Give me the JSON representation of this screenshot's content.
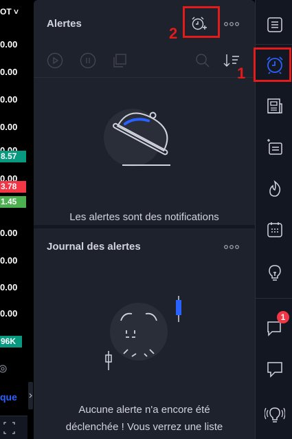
{
  "left_strip": {
    "header": "OT ˅",
    "prices": [
      "0.00",
      "0.00",
      "0.00",
      "0.00",
      "0.00",
      "0.00",
      "0.00",
      "0.00",
      "0.00",
      "0.00"
    ],
    "tags": [
      {
        "text": "8.57",
        "color": "#089981"
      },
      {
        "text": "3.78",
        "color": "#f23645"
      },
      {
        "text": "1.45",
        "color": "#4caf50"
      },
      {
        "text": "96K",
        "color": "#089981"
      }
    ],
    "more_label": "que"
  },
  "alerts_panel": {
    "title": "Alertes",
    "toolbar_icons": [
      "play-circle-icon",
      "pause-circle-icon",
      "copy-icon",
      "search-icon",
      "sort-icon"
    ],
    "empty_message": "Les alertes sont des notifications"
  },
  "log_panel": {
    "title": "Journal des alertes",
    "empty_message_line1": "Aucune alerte n'a encore été",
    "empty_message_line2": "déclenchée ! Vous verrez une liste"
  },
  "right_toolbar": {
    "items": [
      "watchlist-icon",
      "alarm-clock-icon",
      "news-icon",
      "screener-icon",
      "hotlist-icon",
      "calendar-icon",
      "ideas-icon",
      "chat-icon",
      "chat-private-icon",
      "live-icon"
    ],
    "chat_badge": "1"
  },
  "annotations": {
    "label_1": "1",
    "label_2": "2"
  },
  "colors": {
    "panel_bg": "#1e222d",
    "accent_blue": "#2962ff",
    "annotation_red": "#e21b1b"
  }
}
